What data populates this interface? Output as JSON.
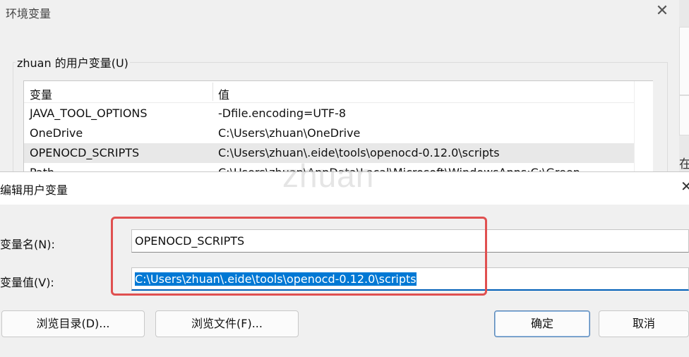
{
  "background_window": {
    "title": "环境变量",
    "close_glyph": "✕",
    "right_edge_text": "在",
    "user_vars_group_label": "zhuan 的用户变量(U)",
    "list": {
      "columns": [
        "变量",
        "值"
      ],
      "rows": [
        {
          "name": "JAVA_TOOL_OPTIONS",
          "value": "-Dfile.encoding=UTF-8"
        },
        {
          "name": "OneDrive",
          "value": "C:\\Users\\zhuan\\OneDrive"
        },
        {
          "name": "OPENOCD_SCRIPTS",
          "value": "C:\\Users\\zhuan\\.eide\\tools\\openocd-0.12.0\\scripts",
          "selected": true
        },
        {
          "name": "Path",
          "value": "C:\\Users\\zhuan\\AppData\\Local\\Microsoft\\WindowsApps;C:\\Green"
        }
      ]
    }
  },
  "watermark": "zhuan",
  "dialog": {
    "title": "编辑用户变量",
    "close_glyph": "✕",
    "name_label": "变量名(N):",
    "name_value": "OPENOCD_SCRIPTS",
    "value_label": "变量值(V):",
    "value_value": "C:\\Users\\zhuan\\.eide\\tools\\openocd-0.12.0\\scripts",
    "buttons": {
      "browse_dir": "浏览目录(D)...",
      "browse_file": "浏览文件(F)...",
      "ok": "确定",
      "cancel": "取消"
    }
  },
  "colors": {
    "highlight_box": "#e05050",
    "selection": "#0078d4",
    "focus_underline": "#005fb8"
  }
}
